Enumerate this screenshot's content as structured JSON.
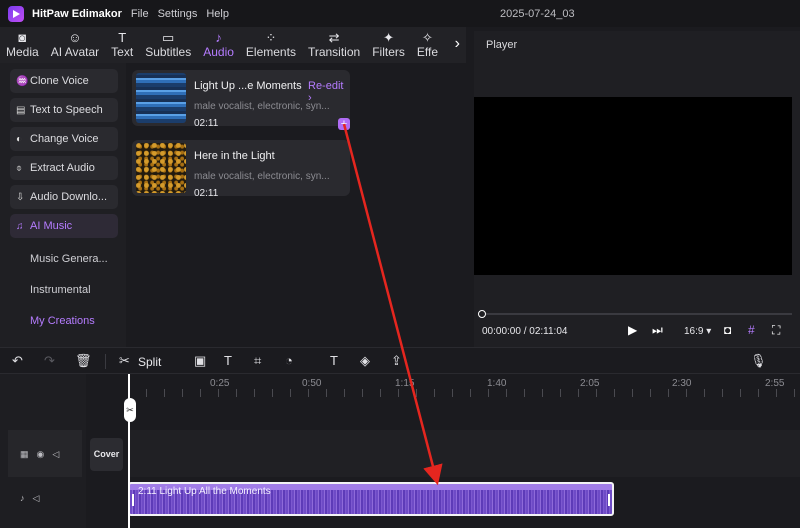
{
  "app": {
    "name": "HitPaw Edimakor",
    "menu": [
      "File",
      "Settings",
      "Help"
    ],
    "project_title": "2025-07-24_03"
  },
  "tabs": [
    {
      "label": "Media",
      "icon": "media-icon",
      "glyph": "◙"
    },
    {
      "label": "AI Avatar",
      "icon": "ai-avatar-icon",
      "glyph": "☺"
    },
    {
      "label": "Text",
      "icon": "text-icon",
      "glyph": "T"
    },
    {
      "label": "Subtitles",
      "icon": "subtitles-icon",
      "glyph": "▭"
    },
    {
      "label": "Audio",
      "icon": "audio-icon",
      "glyph": "♪"
    },
    {
      "label": "Elements",
      "icon": "elements-icon",
      "glyph": "⁘"
    },
    {
      "label": "Transition",
      "icon": "transition-icon",
      "glyph": "⇄"
    },
    {
      "label": "Filters",
      "icon": "filters-icon",
      "glyph": "✦"
    },
    {
      "label": "Effe",
      "icon": "effects-icon",
      "glyph": "✧"
    }
  ],
  "active_tab": "Audio",
  "sidebar": {
    "items": [
      {
        "label": "Clone Voice",
        "glyph": "♒"
      },
      {
        "label": "Text to Speech",
        "glyph": "▤"
      },
      {
        "label": "Change Voice",
        "glyph": "◐"
      },
      {
        "label": "Extract Audio",
        "glyph": "⌽"
      },
      {
        "label": "Audio Downlo...",
        "glyph": "⇩"
      },
      {
        "label": "AI Music",
        "glyph": "♫"
      }
    ],
    "subitems": [
      "Music Genera...",
      "Instrumental",
      "My Creations"
    ]
  },
  "music": [
    {
      "title": "Light Up ...e Moments",
      "action": "Re-edit ›",
      "desc": "male vocalist, electronic, syn...",
      "duration": "02:11",
      "add": "+"
    },
    {
      "title": "Here in the Light",
      "desc": "male vocalist, electronic, syn...",
      "duration": "02:11"
    }
  ],
  "player": {
    "header": "Player",
    "time": "00:00:00 / 02:11:04",
    "ratio": "16:9 ▾"
  },
  "toolbar": {
    "split": "Split"
  },
  "timeline": {
    "ticks": [
      "0:25",
      "0:50",
      "1:15",
      "1:40",
      "2:05",
      "2:30",
      "2:55"
    ],
    "cover": "Cover",
    "clip": {
      "label": "2:11 Light Up All the Moments"
    }
  },
  "colors": {
    "accent": "#b57cff",
    "clip": "#a17de8",
    "arrow": "#e5261f"
  }
}
